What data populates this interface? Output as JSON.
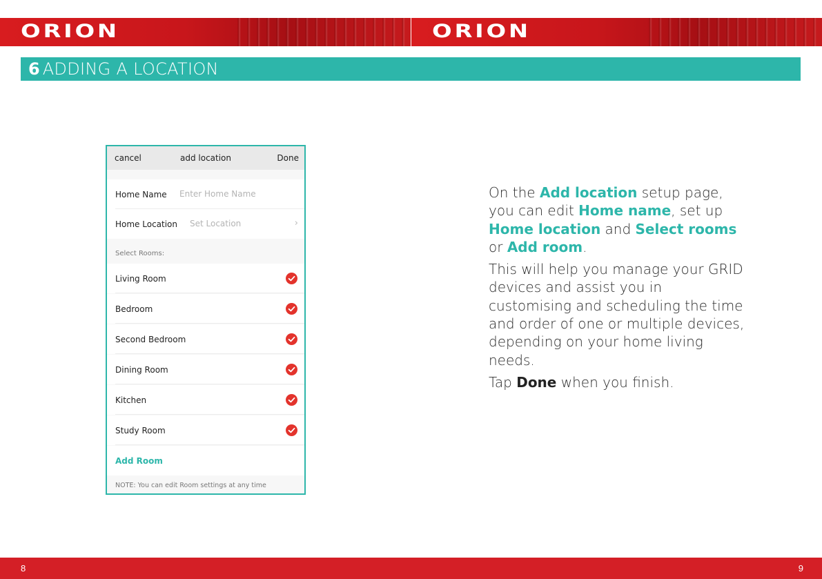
{
  "header": {
    "logo_left": "ORION",
    "logo_right": "ORION"
  },
  "section": {
    "number": "6",
    "title": "ADDING A LOCATION"
  },
  "phone": {
    "navbar": {
      "cancel": "cancel",
      "title": "add location",
      "done": "Done"
    },
    "home_name": {
      "label": "Home Name",
      "placeholder": "Enter Home Name"
    },
    "home_location": {
      "label": "Home Location",
      "placeholder": "Set Location",
      "chevron": "›"
    },
    "select_rooms_label": "Select Rooms:",
    "rooms": [
      {
        "name": "Living Room"
      },
      {
        "name": "Bedroom"
      },
      {
        "name": "Second Bedroom"
      },
      {
        "name": "Dining Room"
      },
      {
        "name": "Kitchen"
      },
      {
        "name": "Study Room"
      }
    ],
    "add_room": "Add Room",
    "note": "NOTE: You can edit Room settings at any time",
    "check_color": "#e3332c"
  },
  "text": {
    "p1_a": "On the ",
    "p1_hl1": "Add location",
    "p1_b": " setup page, you can edit ",
    "p1_hl2": "Home name",
    "p1_c": ", set up ",
    "p1_hl3": "Home location",
    "p1_d": " and ",
    "p1_hl4": "Select rooms",
    "p1_e": " or ",
    "p1_hl5": "Add room",
    "p1_f": ".",
    "p2": "This will help you manage your GRID devices and assist you in customising and scheduling the time and order of one or multiple devices, depending on your home living needs.",
    "p3_a": "Tap ",
    "p3_bold": "Done",
    "p3_b": " when you finish."
  },
  "footer": {
    "page_left": "8",
    "page_right": "9"
  },
  "colors": {
    "accent": "#2db6aa",
    "brand_red": "#d41f26"
  }
}
